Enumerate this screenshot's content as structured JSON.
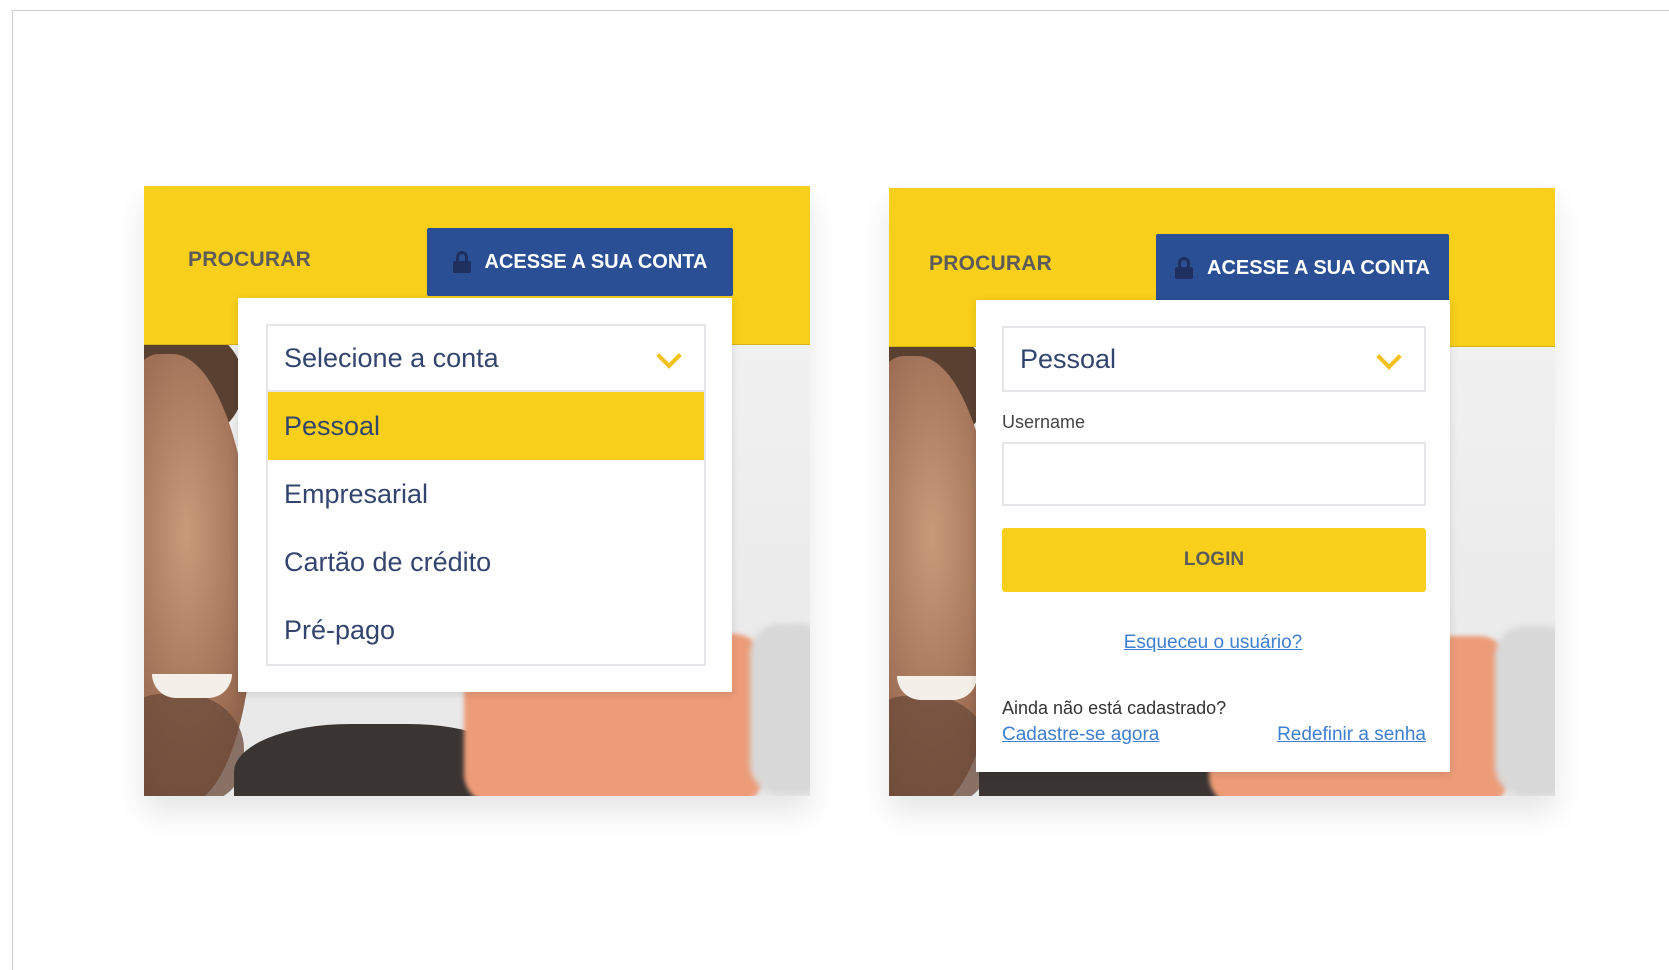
{
  "panels": [
    {
      "header": {
        "search_label": "PROCURAR",
        "account_button_label": "ACESSE A SUA CONTA"
      },
      "select": {
        "value": "Selecione a conta"
      },
      "options": [
        "Pessoal",
        "Empresarial",
        "Cartão de crédito",
        "Pré-pago"
      ],
      "selected_option": "Pessoal"
    },
    {
      "header": {
        "search_label": "PROCURAR",
        "account_button_label": "ACESSE A SUA CONTA"
      },
      "select": {
        "value": "Pessoal"
      },
      "username": {
        "label": "Username",
        "value": ""
      },
      "login_label": "LOGIN",
      "forgot_user": "Esqueceu o usuário?",
      "not_registered": "Ainda não está cadastrado?",
      "signup_link": "Cadastre-se agora",
      "reset_password_link": "Redefinir a senha"
    }
  ],
  "colors": {
    "brand_yellow": "#f8cf1a",
    "brand_blue": "#2a4f94",
    "link_blue": "#3f7fd0",
    "text_navy": "#33456e"
  },
  "icons": [
    "lock-icon",
    "chevron-down-icon"
  ]
}
